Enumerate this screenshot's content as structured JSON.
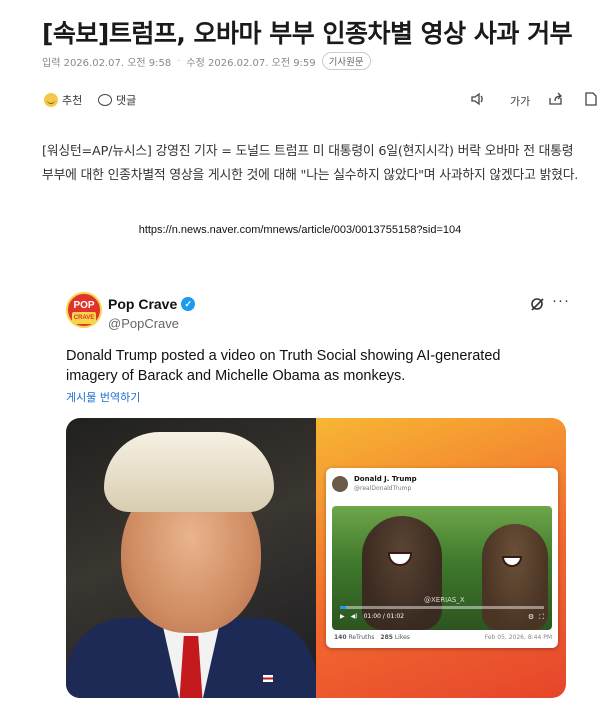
{
  "article": {
    "headline": "[속보]트럼프, 오바마 부부 인종차별 영상 사과 거부",
    "published": "입력 2026.02.07. 오전 9:58",
    "modified": "수정 2026.02.07. 오전 9:59",
    "original_badge": "기사원문",
    "body": "[워싱턴=AP/뉴시스] 강영진 기자 = 도널드 트럼프 미 대통령이 6일(현지시각) 버락 오바마 전 대통령 부부에 대한 인종차별적 영상을 게시한 것에 대해 \"나는 실수하지 않았다\"며 사과하지 않겠다고 밝혔다.",
    "url": "https://n.news.naver.com/mnews/article/003/0013755158?sid=104"
  },
  "actions": {
    "recommend_label": "추천",
    "comment_label": "댓글",
    "font_size_label": "가가"
  },
  "icons": [
    "smile-icon",
    "comment-icon",
    "audio-icon",
    "font-size-icon",
    "share-icon",
    "print-icon",
    "verified-icon",
    "grok-icon",
    "more-icon",
    "play-icon"
  ],
  "colors": {
    "verified": "#1d9bf0",
    "translate_link": "#1d6fd1",
    "orange_start": "#f7b733",
    "orange_end": "#e6452c"
  },
  "tweet": {
    "avatar_text": "POP",
    "avatar_sub": "CRAVE",
    "name": "Pop Crave",
    "handle": "@PopCrave",
    "text": "Donald Trump posted a video on Truth Social showing AI-generated imagery of Barack and Michelle Obama as monkeys.",
    "translate": "게시물 번역하기",
    "embedded": {
      "name": "Donald J. Trump",
      "handle": "@realDonaldTrump",
      "watermark": "@XERIAS_X",
      "time": "01:00 / 01:02",
      "stats_retruths": "140",
      "retruths_label": "ReTruths",
      "stats_likes": "285",
      "likes_label": "Likes",
      "date": "Feb 05, 2026, 8:44 PM",
      "progress": 0.03
    }
  }
}
